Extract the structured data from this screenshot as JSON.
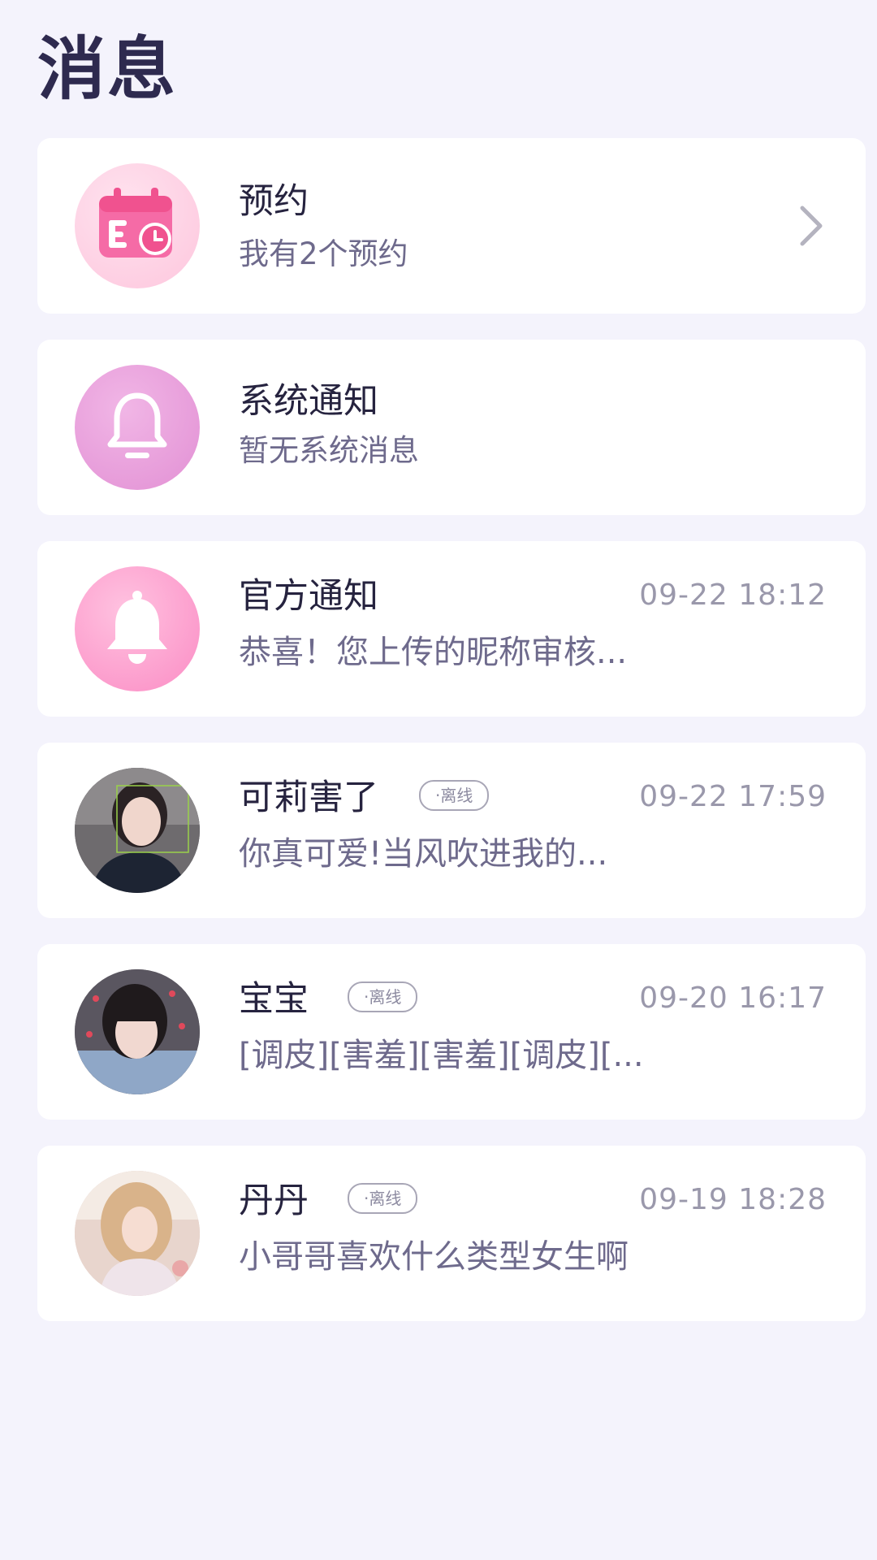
{
  "header": {
    "title": "消息"
  },
  "appointment": {
    "title": "预约",
    "subtitle": "我有2个预约",
    "icon": "calendar-clock-icon"
  },
  "system_notice": {
    "title": "系统通知",
    "subtitle": "暂无系统消息",
    "icon": "bell-outline-icon"
  },
  "official_notice": {
    "title": "官方通知",
    "time": "09-22 18:12",
    "preview": "恭喜！您上传的昵称审核...",
    "icon": "bell-filled-icon"
  },
  "chats": [
    {
      "name": "可莉害了",
      "status": "·离线",
      "time": "09-22 17:59",
      "preview": "你真可爱!当风吹进我的..."
    },
    {
      "name": "宝宝",
      "status": "·离线",
      "time": "09-20 16:17",
      "preview": "[调皮][害羞][害羞][调皮][..."
    },
    {
      "name": "丹丹",
      "status": "·离线",
      "time": "09-19 18:28",
      "preview": "小哥哥喜欢什么类型女生啊"
    }
  ],
  "colors": {
    "background": "#f4f3fc",
    "title_text": "#2e2a4f",
    "subtitle_text": "#6e6a8c",
    "time_text": "#9a98ab",
    "appointment_icon_bg": "#fdd3e6",
    "appointment_icon_fg": "#f25a9c",
    "system_icon_bg": "#e9a3dd",
    "official_icon_bg": "#fda2cf"
  }
}
